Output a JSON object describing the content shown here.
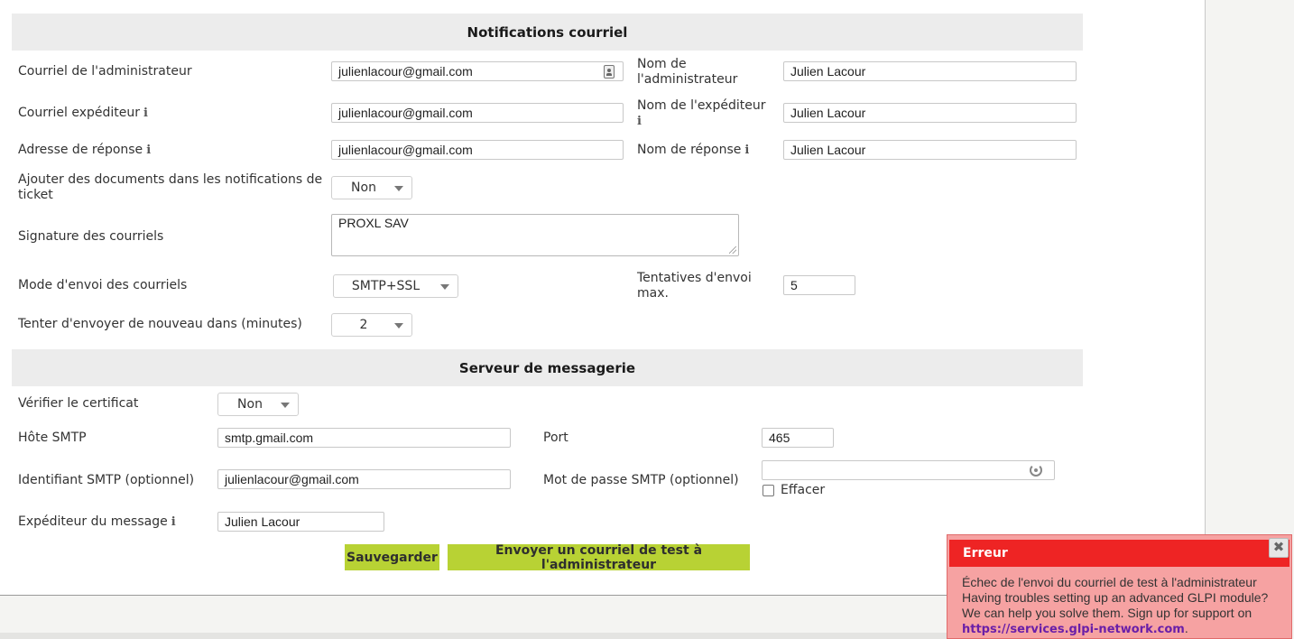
{
  "notifications": {
    "header": "Notifications courriel",
    "admin_email_label": "Courriel de l'administrateur",
    "admin_email_value": "julienlacour@gmail.com",
    "admin_name_label": "Nom de l'administrateur",
    "admin_name_value": "Julien Lacour",
    "sender_email_label": "Courriel expéditeur",
    "sender_email_value": "julienlacour@gmail.com",
    "sender_name_label": "Nom de l'expéditeur",
    "sender_name_value": "Julien Lacour",
    "reply_address_label": "Adresse de réponse",
    "reply_address_value": "julienlacour@gmail.com",
    "reply_name_label": "Nom de réponse",
    "reply_name_value": "Julien Lacour",
    "attach_docs_label": "Ajouter des documents dans les notifications de ticket",
    "attach_docs_value": "Non",
    "signature_label": "Signature des courriels",
    "signature_value": "PROXL SAV",
    "send_mode_label": "Mode d'envoi des courriels",
    "send_mode_value": "SMTP+SSL",
    "max_attempts_label": "Tentatives d'envoi max.",
    "max_attempts_value": "5",
    "retry_label": "Tenter d'envoyer de nouveau dans (minutes)",
    "retry_value": "2",
    "info_glyph": "i"
  },
  "mail_server": {
    "header": "Serveur de messagerie",
    "verify_cert_label": "Vérifier le certificat",
    "verify_cert_value": "Non",
    "smtp_host_label": "Hôte SMTP",
    "smtp_host_value": "smtp.gmail.com",
    "port_label": "Port",
    "port_value": "465",
    "smtp_login_label": "Identifiant SMTP (optionnel)",
    "smtp_login_value": "julienlacour@gmail.com",
    "smtp_password_label": "Mot de passe SMTP (optionnel)",
    "smtp_password_value": "",
    "clear_label": "Effacer",
    "message_sender_label": "Expéditeur du message",
    "message_sender_value": "Julien Lacour"
  },
  "buttons": {
    "save": "Sauvegarder",
    "send_test": "Envoyer un courriel de test à l'administrateur"
  },
  "toast": {
    "title": "Erreur",
    "close_glyph": "✖",
    "line1": "Échec de l'envoi du courriel de test à l'administrateur",
    "line2": "Having troubles setting up an advanced GLPI module?",
    "line3": "We can help you solve them. Sign up for support on",
    "link": "https://services.glpi-network.com",
    "link_suffix": "."
  },
  "colors": {
    "button": "#b8d234",
    "toast_header": "#ee2424",
    "toast_bg": "#f6a2a2",
    "section_header_bg": "#ececec"
  }
}
